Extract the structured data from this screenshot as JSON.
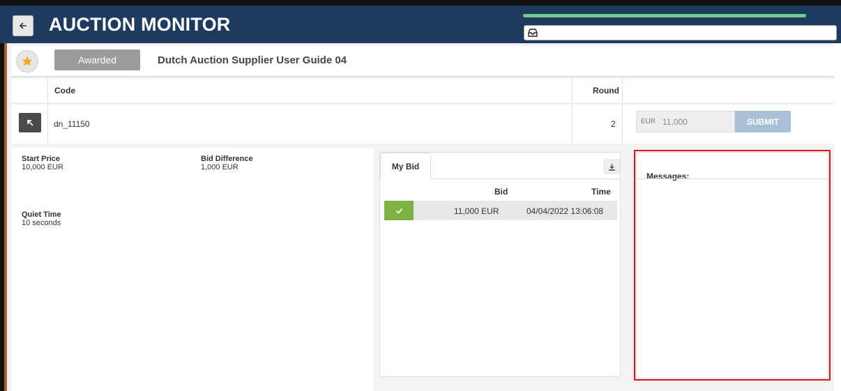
{
  "app": {
    "title": "AUCTION MONITOR",
    "progress_fraction": 1.0,
    "accent_color": "#1e3a5f",
    "progress_color": "#6fcf8b"
  },
  "auction": {
    "status_label": "Awarded",
    "name": "Dutch Auction Supplier User Guide 04"
  },
  "table": {
    "headers": {
      "code": "Code",
      "round": "Round"
    },
    "row": {
      "code": "dn_11150",
      "round": "2"
    }
  },
  "bid_form": {
    "currency": "EUR",
    "value": "11,000",
    "submit_label": "SUBMIT"
  },
  "details": {
    "start_price": {
      "label": "Start Price",
      "value": "10,000 EUR"
    },
    "bid_difference": {
      "label": "Bid Difference",
      "value": "1,000 EUR"
    },
    "quiet_time": {
      "label": "Quiet Time",
      "value": "10 seconds"
    }
  },
  "my_bid": {
    "tab_label": "My Bid",
    "headers": {
      "bid": "Bid",
      "time": "Time"
    },
    "rows": [
      {
        "bid": "11,000 EUR",
        "time": "04/04/2022 13:06:08",
        "status": "accepted"
      }
    ]
  },
  "messages": {
    "title": "Messages:"
  },
  "icons": {
    "back": "arrow-left-icon",
    "inbox": "inbox-icon",
    "star": "star-icon",
    "open": "arrow-up-left-icon",
    "download": "download-icon",
    "check": "check-icon"
  }
}
